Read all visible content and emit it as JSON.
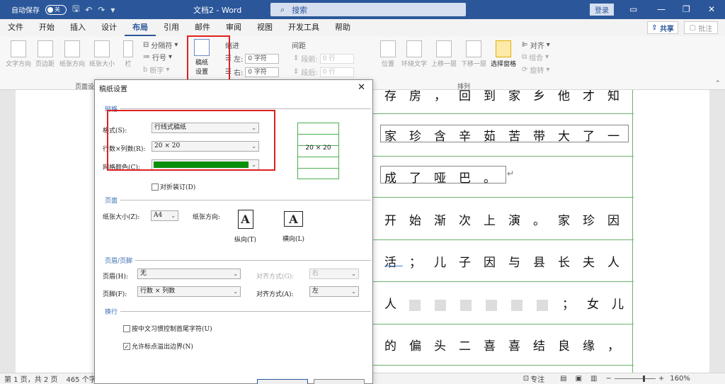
{
  "titlebar": {
    "autosave_label": "自动保存",
    "autosave_state": "关",
    "doc_title": "文档2 - Word",
    "search_placeholder": "搜索",
    "login_label": "登录",
    "minimize": "—",
    "restore": "❐",
    "close": "✕"
  },
  "menu": [
    "文件",
    "开始",
    "插入",
    "设计",
    "布局",
    "引用",
    "邮件",
    "审阅",
    "视图",
    "开发工具",
    "帮助"
  ],
  "menu_active": "布局",
  "share_label": "共享",
  "comment_label": "批注",
  "ribbon": {
    "text_direction": "文字方向",
    "margins": "页边距",
    "orientation": "纸张方向",
    "size": "纸张大小",
    "columns": "栏",
    "breaks": "分隔符",
    "line_numbers": "行号",
    "hyphenation": "断字",
    "manuscript_line1": "稿纸",
    "manuscript_line2": "设置",
    "indent_header": "缩进",
    "spacing_header": "间距",
    "indent_left_label": "左:",
    "indent_left_value": "0 字符",
    "indent_right_label": "右:",
    "indent_right_value": "0 字符",
    "space_before_label": "段前:",
    "space_before_value": "0 行",
    "space_after_label": "段后:",
    "space_after_value": "0 行",
    "position": "位置",
    "wrap_text": "环绕文字",
    "bring_forward": "上移一层",
    "send_backward": "下移一层",
    "selection_pane": "选择窗格",
    "align": "对齐",
    "group": "组合",
    "rotate": "旋转",
    "group_page_setup": "页面设",
    "group_arrange": "排列"
  },
  "document": {
    "lines": [
      "存房，回到家乡他才知",
      "家珍含辛茹苦带大了一",
      "成了哑巴。",
      "开始渐次上演。家珍因",
      "活；儿子因与县长夫人",
      "人",
      "的偏头二喜喜结良缘，"
    ],
    "line4_tail": "；女儿"
  },
  "dialog": {
    "title": "稿纸设置",
    "close": "✕",
    "section_grid": "网格",
    "style_label": "格式(S):",
    "style_value": "行线式稿纸",
    "rows_cols_label": "行数×列数(R):",
    "rows_cols_value": "20 × 20",
    "grid_color_label": "网格颜色(C):",
    "grid_color_hex": "#0a8f0a",
    "fold_label": "对折装订(D)",
    "preview_text": "20 × 20",
    "section_page": "页面",
    "paper_size_label": "纸张大小(Z):",
    "paper_size_value": "A4",
    "orientation_label": "纸张方向:",
    "portrait": "纵向(T)",
    "landscape": "横向(L)",
    "section_hf": "页眉/页脚",
    "header_label": "页眉(H):",
    "header_value": "无",
    "header_align_label": "对齐方式(G):",
    "header_align_value": "右",
    "footer_label": "页脚(F):",
    "footer_value": "行数 × 列数",
    "footer_align_label": "对齐方式(A):",
    "footer_align_value": "左",
    "section_wrap": "换行",
    "wrap_opt1": "按中文习惯控制首尾字符(U)",
    "wrap_opt2": "允许标点溢出边界(N)",
    "wrap_opt2_checked": "✓"
  },
  "status": {
    "page": "第 1 页，共 2 页",
    "words": "465 个字",
    "focus": "专注",
    "zoom": "160%"
  },
  "colors": {
    "accent": "#2b579a",
    "highlight": "#e02020",
    "grid": "#4caf50"
  }
}
